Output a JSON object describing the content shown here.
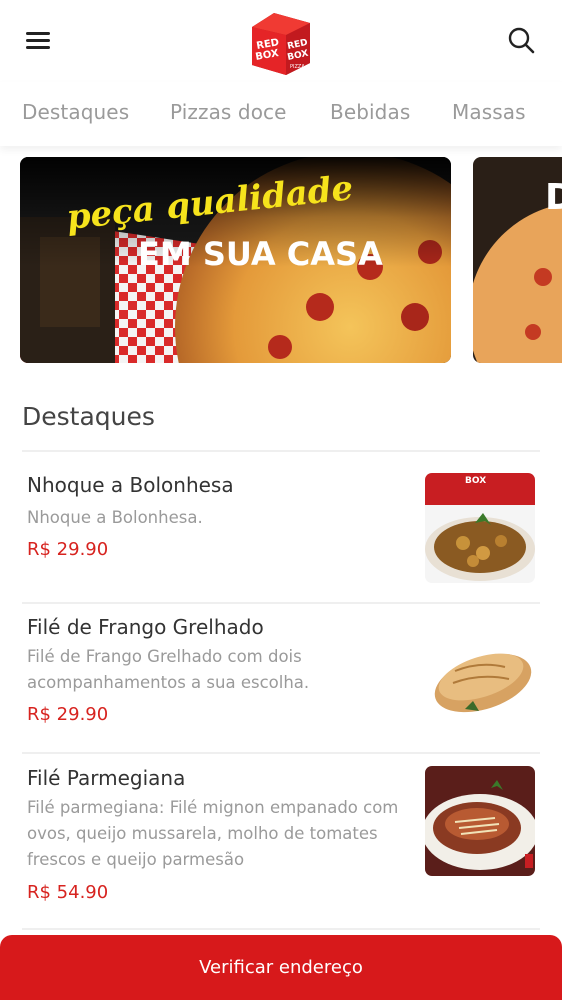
{
  "header": {
    "menu_icon": "hamburger-menu-icon",
    "search_icon": "search-icon",
    "logo_line1": "RED",
    "logo_line2": "BOX",
    "logo_tag": "PIZZA",
    "brand_color": "#d7191b"
  },
  "tabs": [
    {
      "label": "Destaques"
    },
    {
      "label": "Pizzas doce"
    },
    {
      "label": "Bebidas"
    },
    {
      "label": "Massas"
    }
  ],
  "banners": [
    {
      "line1": "peça qualidade",
      "line2": "EM SUA CASA"
    },
    {
      "line1": "D"
    }
  ],
  "section": {
    "title": "Destaques"
  },
  "items": [
    {
      "name": "Nhoque a Bolonhesa",
      "desc_lines": [
        "Nhoque a Bolonhesa."
      ],
      "price": "R$ 29.90",
      "image_label": "BOX"
    },
    {
      "name": "Filé de Frango Grelhado",
      "desc_lines": [
        "Filé de Frango Grelhado com dois",
        "acompanhamentos a sua escolha."
      ],
      "price": "R$ 29.90"
    },
    {
      "name": "Filé Parmegiana",
      "desc_lines": [
        "Filé parmegiana: Filé mignon empanado com",
        "ovos, queijo mussarela, molho de tomates",
        "frescos e queijo parmesão"
      ],
      "price": "R$ 54.90"
    }
  ],
  "cta": {
    "label": "Verificar endereço"
  },
  "colors": {
    "price": "#d7231f",
    "cta_bg": "#d7191b",
    "tab_text": "#9a9a9a"
  }
}
